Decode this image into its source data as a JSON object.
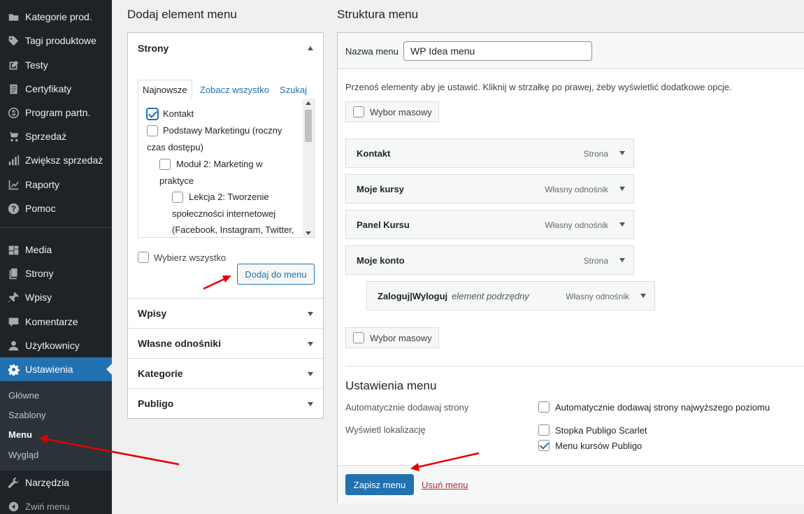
{
  "sidebar": {
    "items": [
      {
        "label": "Kategorie prod.",
        "icon": "folder-icon"
      },
      {
        "label": "Tagi produktowe",
        "icon": "tag-icon"
      },
      {
        "label": "Testy",
        "icon": "edit-icon"
      },
      {
        "label": "Certyfikaty",
        "icon": "document-icon"
      },
      {
        "label": "Program partn.",
        "icon": "dollar-icon"
      },
      {
        "label": "Sprzedaż",
        "icon": "cart-icon"
      },
      {
        "label": "Zwiększ sprzedaż",
        "icon": "bar-chart-icon"
      },
      {
        "label": "Raporty",
        "icon": "line-chart-icon"
      },
      {
        "label": "Pomoc",
        "icon": "help-icon"
      },
      {
        "label": "Media",
        "icon": "media-icon"
      },
      {
        "label": "Strony",
        "icon": "pages-icon"
      },
      {
        "label": "Wpisy",
        "icon": "pin-icon"
      },
      {
        "label": "Komentarze",
        "icon": "comment-icon"
      },
      {
        "label": "Użytkownicy",
        "icon": "user-icon"
      },
      {
        "label": "Ustawienia",
        "icon": "settings-icon"
      }
    ],
    "submenu": [
      "Główne",
      "Szablony",
      "Menu",
      "Wygląd"
    ],
    "tools": {
      "label": "Narzędzia",
      "icon": "wrench-icon"
    },
    "collapse": {
      "label": "Zwiń menu",
      "icon": "collapse-icon"
    }
  },
  "left": {
    "title": "Dodaj element menu",
    "strony": {
      "label": "Strony",
      "tabs": [
        "Najnowsze",
        "Zobacz wszystko",
        "Szukaj"
      ],
      "pages": [
        {
          "line1": "Kontakt",
          "checked": true
        },
        {
          "line1": "Podstawy Marketingu (roczny",
          "line2": "czas dostępu)",
          "checked": false
        },
        {
          "line1": "Moduł 2: Marketing w",
          "line2": "praktyce",
          "checked": false
        },
        {
          "line1": "Lekcja 2: Tworzenie",
          "line2": "społeczności internetowej",
          "line3": "(Facebook, Instagram, Twitter,",
          "checked": false
        }
      ],
      "select_all": "Wybierz wszystko",
      "add_button": "Dodaj do menu"
    },
    "sections": [
      "Wpisy",
      "Własne odnośniki",
      "Kategorie",
      "Publigo"
    ]
  },
  "right": {
    "title": "Struktura menu",
    "name_label": "Nazwa menu",
    "name_value": "WP Idea menu",
    "hint": "Przenoś elementy aby je ustawić. Kliknij w strzałkę po prawej, żeby wyświetlić dodatkowe opcje.",
    "bulk_select": "Wybor masowy",
    "items": [
      {
        "title": "Kontakt",
        "type": "Strona"
      },
      {
        "title": "Moje kursy",
        "type": "Własny odnośnik"
      },
      {
        "title": "Panel Kursu",
        "type": "Własny odnośnik"
      },
      {
        "title": "Moje konto",
        "type": "Strona"
      },
      {
        "title": "Zaloguj|Wyloguj",
        "sub": "element podrzędny",
        "type": "Własny odnośnik"
      }
    ],
    "settings": {
      "title": "Ustawienia menu",
      "auto_add_label": "Automatycznie dodawaj strony",
      "auto_add_option": "Automatycznie dodawaj strony najwyższego poziomu",
      "locations_label": "Wyświetl lokalizację",
      "locations": [
        {
          "label": "Stopka Publigo Scarlet",
          "checked": false
        },
        {
          "label": "Menu kursów Publigo",
          "checked": true
        }
      ]
    },
    "save_button": "Zapisz menu",
    "delete_link": "Usuń menu"
  },
  "colors": {
    "accent": "#2271b1",
    "sidebar": "#1d2327",
    "arrow": "#e00000",
    "danger": "#b32d2e"
  }
}
